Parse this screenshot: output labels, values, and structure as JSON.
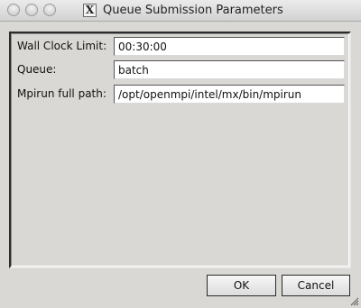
{
  "window": {
    "title": "Queue Submission Parameters",
    "x11_glyph": "X",
    "controls": [
      "close",
      "minimize",
      "zoom"
    ]
  },
  "form": {
    "fields": [
      {
        "label": "Wall Clock Limit:",
        "value": "00:30:00"
      },
      {
        "label": "Queue:",
        "value": "batch"
      },
      {
        "label": "Mpirun full path:",
        "value": "/opt/openmpi/intel/mx/bin/mpirun"
      }
    ]
  },
  "buttons": {
    "ok_label": "OK",
    "cancel_label": "Cancel"
  },
  "icons": {
    "close": "close-circle-icon",
    "minimize": "minimize-circle-icon",
    "zoom": "zoom-circle-icon",
    "app": "x11-icon",
    "resize": "resize-grip-icon"
  }
}
